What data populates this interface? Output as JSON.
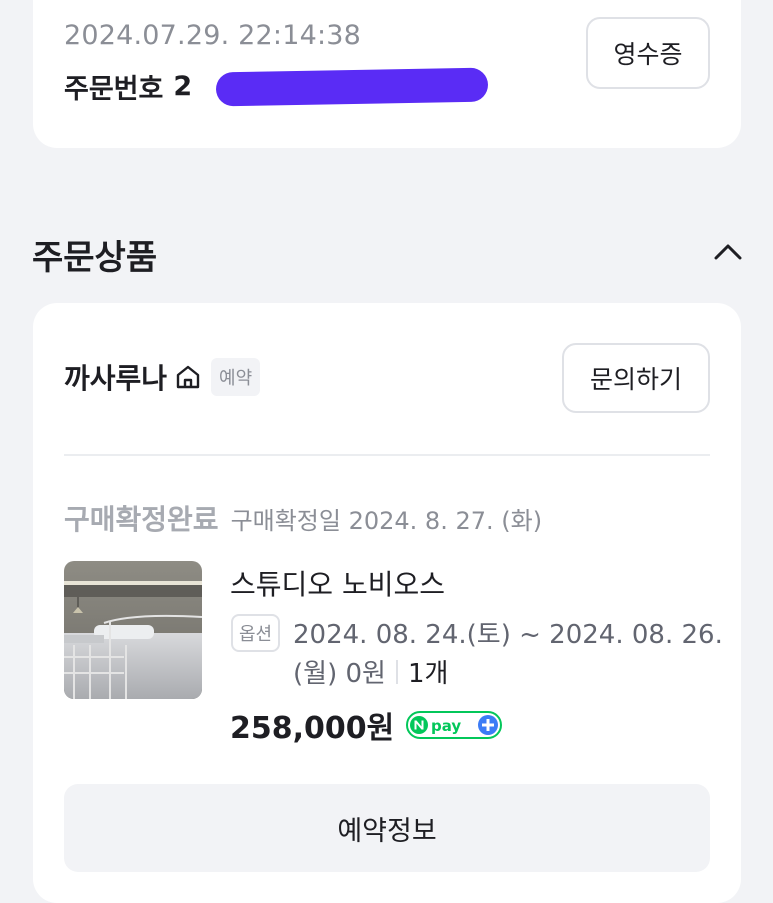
{
  "order": {
    "datetime": "2024.07.29. 22:14:38",
    "number_label": "주문번호",
    "number_visible_prefix": "2",
    "receipt_label": "영수증"
  },
  "section": {
    "title": "주문상품"
  },
  "store": {
    "name": "까사루나",
    "badge": "예약",
    "inquiry_label": "문의하기"
  },
  "status": {
    "label": "구매확정완료",
    "date": "구매확정일 2024. 8. 27. (화)"
  },
  "product": {
    "name": "스튜디오 노비오스",
    "option_badge": "옵션",
    "option_line1": "2024. 08. 24.(토) ~ 2024. 08. 26.",
    "option_line2": "(월) 0원",
    "quantity": "1개",
    "price": "258,000원"
  },
  "actions": {
    "reservation_label": "예약정보"
  },
  "colors": {
    "background": "#f2f3f6",
    "card": "#ffffff",
    "npay_green": "#03c75a",
    "npay_blue": "#3c7cf6",
    "redaction": "#5a2cf5"
  },
  "icons": {
    "store_home": "home-icon",
    "collapse": "chevron-up-icon",
    "pay": "npay-plus-logo"
  }
}
